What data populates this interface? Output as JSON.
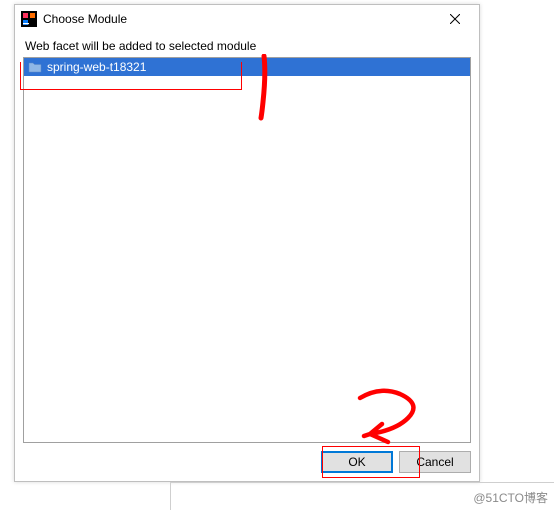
{
  "dialog": {
    "title": "Choose Module",
    "subtitle": "Web facet will be added to selected module",
    "modules": [
      {
        "name": "spring-web-t18321",
        "selected": true
      }
    ],
    "ok_label": "OK",
    "cancel_label": "Cancel"
  },
  "annotations": {
    "mark1": "1",
    "mark2": "2"
  },
  "watermark": "@51CTO博客"
}
